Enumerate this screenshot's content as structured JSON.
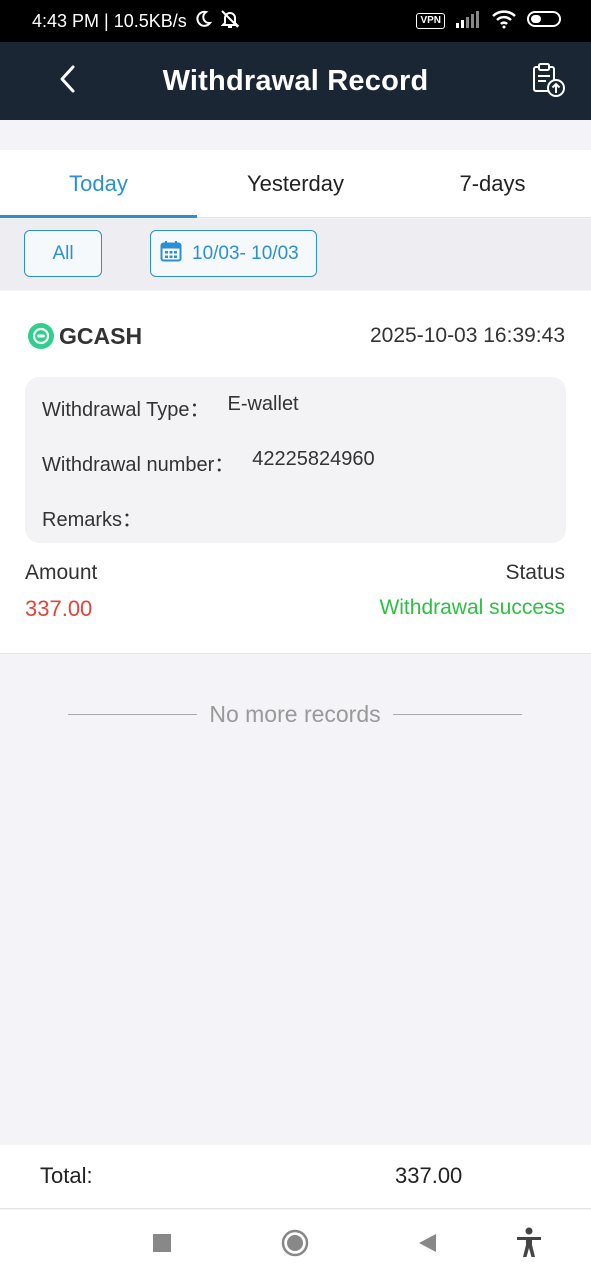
{
  "status_bar": {
    "time_speed": "4:43 PM | 10.5KB/s",
    "vpn": "VPN",
    "icons": [
      "moon-icon",
      "bell-off-icon",
      "signal-icon",
      "wifi-icon",
      "battery-icon"
    ]
  },
  "header": {
    "title": "Withdrawal Record",
    "back_icon": "chevron-left-icon",
    "action_icon": "clipboard-upload-icon"
  },
  "tabs": [
    {
      "label": "Today",
      "active": true
    },
    {
      "label": "Yesterday",
      "active": false
    },
    {
      "label": "7-days",
      "active": false
    }
  ],
  "filters": {
    "all_label": "All",
    "date_range": "10/03- 10/03",
    "date_icon": "calendar-icon"
  },
  "records": [
    {
      "method": "GCASH",
      "datetime": "2025-10-03 16:39:43",
      "type_label": "Withdrawal Type：",
      "type_value": "E-wallet",
      "number_label": "Withdrawal number：",
      "number_value": "42225824960",
      "remarks_label": "Remarks：",
      "remarks_value": "",
      "amount_label": "Amount",
      "amount_value": "337.00",
      "status_label": "Status",
      "status_value": "Withdrawal success"
    }
  ],
  "no_more": "No more records",
  "total": {
    "label": "Total:",
    "value": "337.00"
  },
  "nav": [
    "square-icon",
    "circle-home-icon",
    "triangle-back-icon",
    "accessibility-icon"
  ],
  "colors": {
    "header_bg": "#1b2634",
    "accent": "#2b8fd4",
    "amount": "#e0443a",
    "success": "#2ec042",
    "gcash": "#2fcf8e"
  }
}
